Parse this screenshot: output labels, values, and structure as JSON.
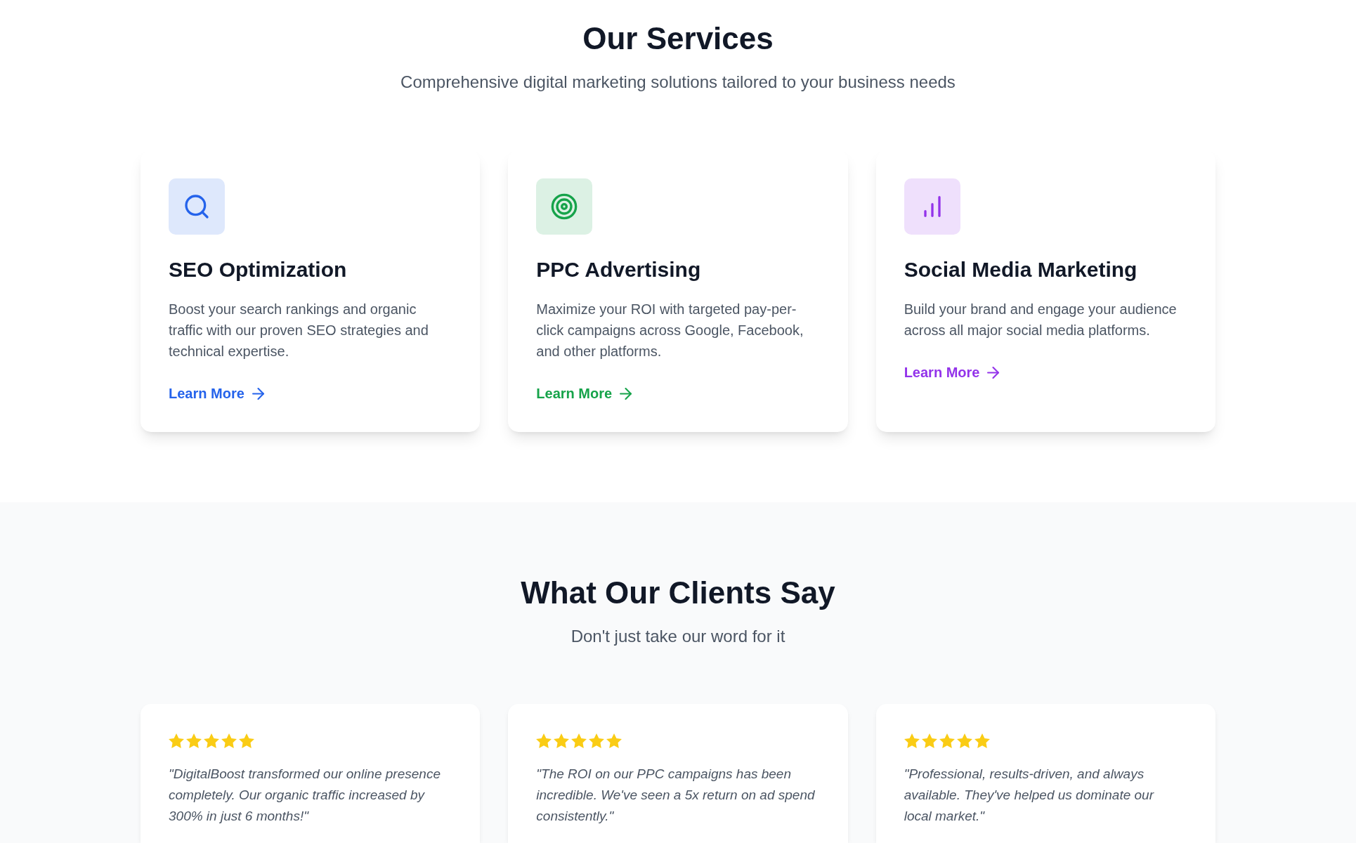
{
  "services": {
    "title": "Our Services",
    "subtitle": "Comprehensive digital marketing solutions tailored to your business needs",
    "cards": [
      {
        "color": "#2563eb",
        "title": "SEO Optimization",
        "description": "Boost your search rankings and organic traffic with our proven SEO strategies and technical expertise.",
        "link": "Learn More"
      },
      {
        "color": "#16a34a",
        "title": "PPC Advertising",
        "description": "Maximize your ROI with targeted pay-per-click campaigns across Google, Facebook, and other platforms.",
        "link": "Learn More"
      },
      {
        "color": "#9333ea",
        "title": "Social Media Marketing",
        "description": "Build your brand and engage your audience across all major social media platforms.",
        "link": "Learn More"
      }
    ]
  },
  "testimonials": {
    "title": "What Our Clients Say",
    "subtitle": "Don't just take our word for it",
    "cards": [
      {
        "stars": 5,
        "quote": "\"DigitalBoost transformed our online presence completely. Our organic traffic increased by 300% in just 6 months!\""
      },
      {
        "stars": 5,
        "quote": "\"The ROI on our PPC campaigns has been incredible. We've seen a 5x return on ad spend consistently.\""
      },
      {
        "stars": 5,
        "quote": "\"Professional, results-driven, and always available. They've helped us dominate our local market.\""
      }
    ]
  }
}
